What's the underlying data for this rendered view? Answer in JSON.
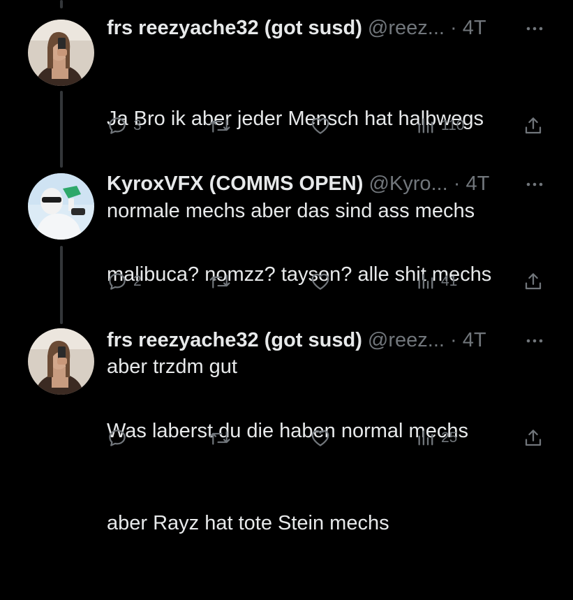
{
  "colors": {
    "background": "#000000",
    "text": "#e7e9ea",
    "muted": "#71767b",
    "thread_line": "#333639"
  },
  "tweets": [
    {
      "name": "frs reezyache32 (got susd)",
      "handle": "@reez...",
      "dot": "·",
      "time": "4T",
      "line1": "Ja Bro ik aber jeder Mensch hat halbwegs",
      "line2": "normale mechs aber das sind ass mechs",
      "replies": "3",
      "views": "110",
      "avatar": "girl-mirror-selfie-avatar"
    },
    {
      "name": "KyroxVFX (COMMS OPEN)",
      "handle": "@Kyro...",
      "dot": "·",
      "time": "4T",
      "line1": "malibuca? nomzz? tayson? alle shit mechs",
      "line2": "aber trzdm gut",
      "replies": "2",
      "views": "41",
      "avatar": "masked-person-avatar"
    },
    {
      "name": "frs reezyache32 (got susd)",
      "handle": "@reez...",
      "dot": "·",
      "time": "4T",
      "line1": "Was laberst du die haben normal mechs",
      "line2": "aber Rayz hat tote Stein mechs",
      "replies": "",
      "views": "25",
      "avatar": "girl-mirror-selfie-avatar"
    }
  ],
  "icons": [
    "reply-icon",
    "retweet-icon",
    "like-icon",
    "views-icon",
    "share-icon",
    "more-icon"
  ]
}
